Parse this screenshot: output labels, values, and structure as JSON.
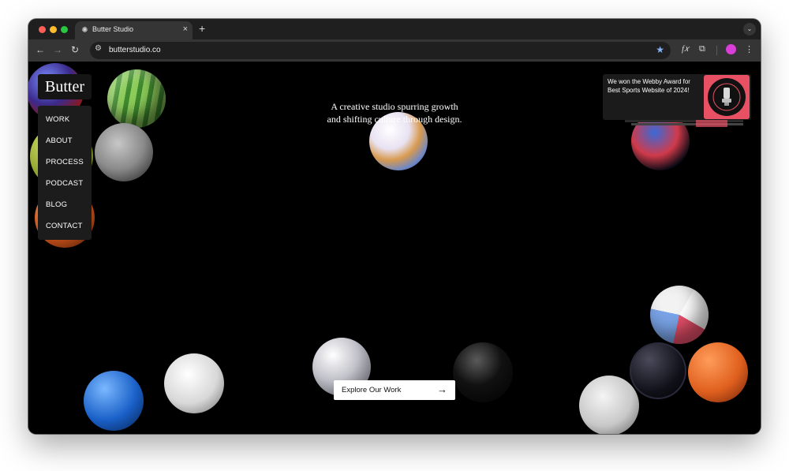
{
  "browser": {
    "tab_title": "Butter Studio",
    "tab_close": "×",
    "new_tab": "+",
    "url": "butterstudio.co"
  },
  "site": {
    "logo": "Butter",
    "nav": [
      {
        "label": "WORK"
      },
      {
        "label": "ABOUT"
      },
      {
        "label": "PROCESS"
      },
      {
        "label": "PODCAST"
      },
      {
        "label": "BLOG"
      },
      {
        "label": "CONTACT"
      }
    ],
    "tagline_line1": "A creative studio spurring growth",
    "tagline_line2": "and shifting culture through design.",
    "award_text": "We won the Webby Award for Best Sports Website of 2024!",
    "badge_text": "WEBBY AWARD WINNER",
    "cta_label": "Explore Our Work",
    "cta_arrow": "→"
  },
  "colors": {
    "background": "#000000",
    "menu_bg": "#1c1c1c",
    "badge_pink": "#e85064",
    "profile_purple": "#d93ed9",
    "star_blue": "#8ab4f8"
  }
}
